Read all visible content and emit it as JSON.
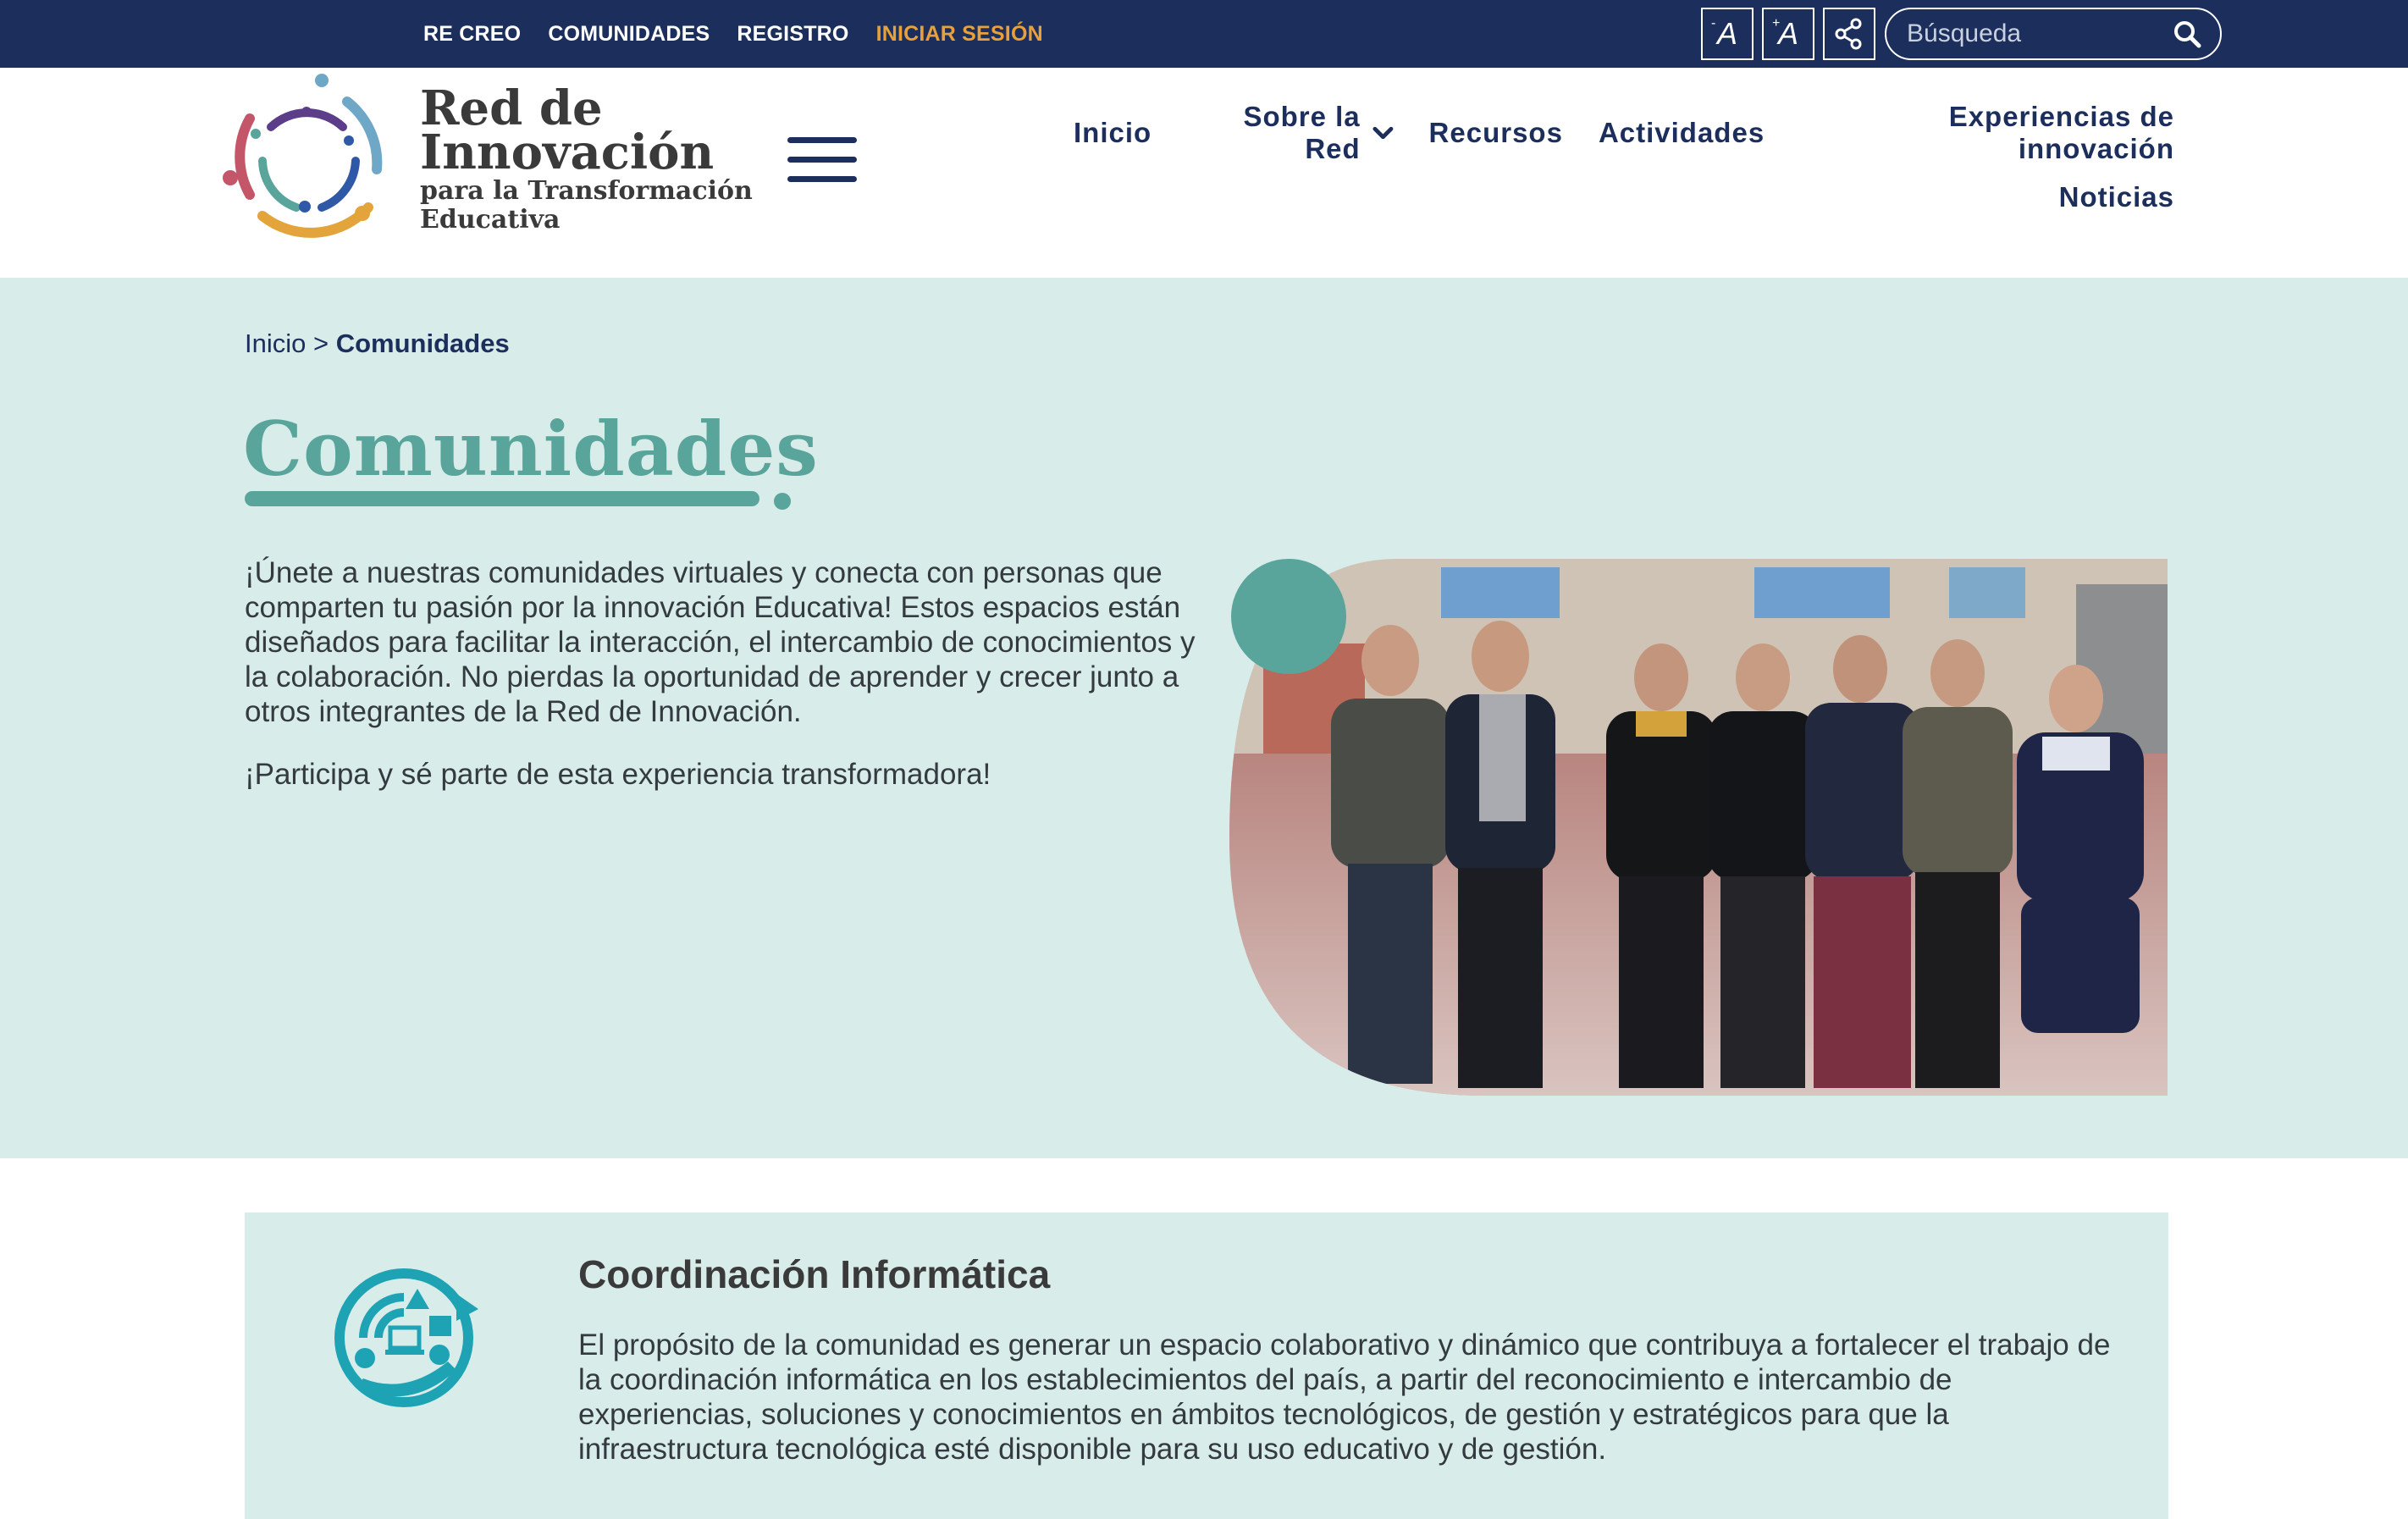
{
  "topbar": {
    "links": [
      "RE CREO",
      "COMUNIDADES",
      "REGISTRO",
      "INICIAR SESIÓN"
    ],
    "decrease_font_label": "A",
    "decrease_font_sign": "-",
    "increase_font_label": "A",
    "increase_font_sign": "+",
    "search_placeholder": "Búsqueda"
  },
  "logo": {
    "line1": "Red de",
    "line2": "Innovación",
    "line3": "para la Transformación",
    "line4": "Educativa"
  },
  "nav": {
    "items": [
      "Inicio",
      "Sobre la Red",
      "Recursos",
      "Actividades",
      "Experiencias de innovación",
      "Noticias"
    ]
  },
  "breadcrumb": {
    "home": "Inicio",
    "separator": ">",
    "current": "Comunidades"
  },
  "page": {
    "title": "Comunidades",
    "intro_p1": "¡Únete a nuestras comunidades virtuales y conecta con personas que comparten tu pasión por la innovación Educativa! Estos espacios están diseñados para facilitar la interacción, el intercambio de conocimientos y la colaboración. No pierdas la oportunidad de aprender y crecer junto a otros integrantes de la Red de Innovación.",
    "intro_p2": "¡Participa y sé parte de esta experiencia transformadora!"
  },
  "community": {
    "title": "Coordinación Informática",
    "description": "El propósito de la comunidad es generar un espacio colaborativo y dinámico que contribuya a fortalecer el trabajo de la coordinación informática en los establecimientos del país, a partir del reconocimiento e intercambio de experiencias, soluciones y conocimientos en ámbitos tecnológicos, de gestión y estratégicos para que la infraestructura tecnológica esté disponible para su uso educativo y de gestión.",
    "icon": "it-coordination-icon"
  },
  "colors": {
    "topbar": "#1c2f5c",
    "accent_teal": "#5aa59b",
    "hero_bg": "#d8ecea",
    "login": "#e8a03a"
  }
}
